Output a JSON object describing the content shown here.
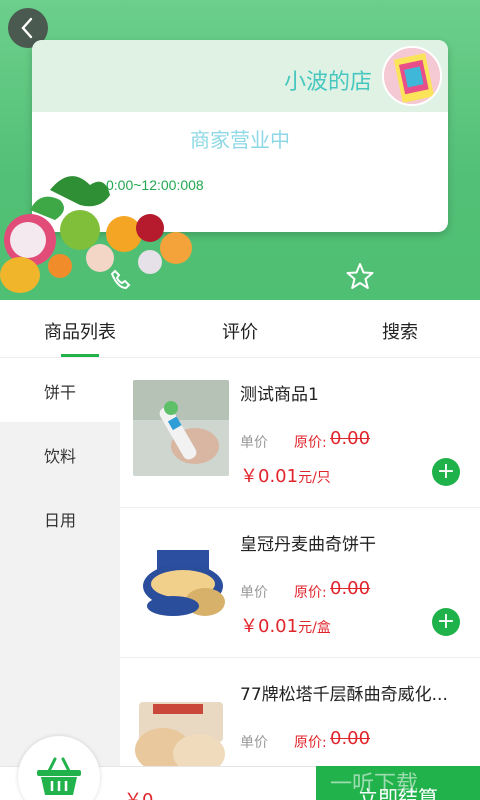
{
  "shop": {
    "name": "小波的店",
    "status": "商家营业中",
    "hours": "0:00~12:00:008"
  },
  "tabs": [
    {
      "label": "商品列表",
      "active": true
    },
    {
      "label": "评价",
      "active": false
    },
    {
      "label": "搜索",
      "active": false
    }
  ],
  "categories": [
    {
      "label": "饼干",
      "active": true
    },
    {
      "label": "饮料",
      "active": false
    },
    {
      "label": "日用",
      "active": false
    }
  ],
  "products": [
    {
      "name": "测试商品1",
      "unit_label": "单价",
      "orig_label": "原价:",
      "orig_price": "0.00",
      "price": "￥0.01",
      "unit": "元/只"
    },
    {
      "name": "皇冠丹麦曲奇饼干",
      "unit_label": "单价",
      "orig_label": "原价:",
      "orig_price": "0.00",
      "price": "￥0.01",
      "unit": "元/盒"
    },
    {
      "name": "77牌松塔千层酥曲奇威化...",
      "unit_label": "单价",
      "orig_label": "原价:",
      "orig_price": "0.00",
      "price": "",
      "unit": ""
    }
  ],
  "cart": {
    "total": "￥0",
    "checkout_label": "立即结算"
  },
  "watermark": "一听下载",
  "icons": {
    "back": "chevron-left-icon",
    "phone": "phone-icon",
    "favorite": "star-icon",
    "add": "plus-icon",
    "cart": "basket-icon"
  },
  "colors": {
    "brand_green": "#22b24c",
    "price_red": "#e0262d",
    "header_green": "#52c076"
  }
}
